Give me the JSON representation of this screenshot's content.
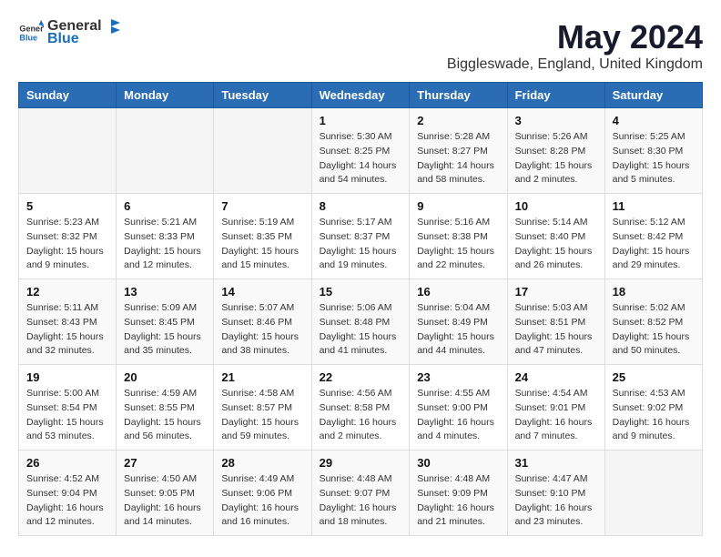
{
  "header": {
    "logo_general": "General",
    "logo_blue": "Blue",
    "title": "May 2024",
    "subtitle": "Biggleswade, England, United Kingdom"
  },
  "calendar": {
    "columns": [
      "Sunday",
      "Monday",
      "Tuesday",
      "Wednesday",
      "Thursday",
      "Friday",
      "Saturday"
    ],
    "rows": [
      [
        {
          "day": "",
          "sunrise": "",
          "sunset": "",
          "daylight": ""
        },
        {
          "day": "",
          "sunrise": "",
          "sunset": "",
          "daylight": ""
        },
        {
          "day": "",
          "sunrise": "",
          "sunset": "",
          "daylight": ""
        },
        {
          "day": "1",
          "sunrise": "Sunrise: 5:30 AM",
          "sunset": "Sunset: 8:25 PM",
          "daylight": "Daylight: 14 hours and 54 minutes."
        },
        {
          "day": "2",
          "sunrise": "Sunrise: 5:28 AM",
          "sunset": "Sunset: 8:27 PM",
          "daylight": "Daylight: 14 hours and 58 minutes."
        },
        {
          "day": "3",
          "sunrise": "Sunrise: 5:26 AM",
          "sunset": "Sunset: 8:28 PM",
          "daylight": "Daylight: 15 hours and 2 minutes."
        },
        {
          "day": "4",
          "sunrise": "Sunrise: 5:25 AM",
          "sunset": "Sunset: 8:30 PM",
          "daylight": "Daylight: 15 hours and 5 minutes."
        }
      ],
      [
        {
          "day": "5",
          "sunrise": "Sunrise: 5:23 AM",
          "sunset": "Sunset: 8:32 PM",
          "daylight": "Daylight: 15 hours and 9 minutes."
        },
        {
          "day": "6",
          "sunrise": "Sunrise: 5:21 AM",
          "sunset": "Sunset: 8:33 PM",
          "daylight": "Daylight: 15 hours and 12 minutes."
        },
        {
          "day": "7",
          "sunrise": "Sunrise: 5:19 AM",
          "sunset": "Sunset: 8:35 PM",
          "daylight": "Daylight: 15 hours and 15 minutes."
        },
        {
          "day": "8",
          "sunrise": "Sunrise: 5:17 AM",
          "sunset": "Sunset: 8:37 PM",
          "daylight": "Daylight: 15 hours and 19 minutes."
        },
        {
          "day": "9",
          "sunrise": "Sunrise: 5:16 AM",
          "sunset": "Sunset: 8:38 PM",
          "daylight": "Daylight: 15 hours and 22 minutes."
        },
        {
          "day": "10",
          "sunrise": "Sunrise: 5:14 AM",
          "sunset": "Sunset: 8:40 PM",
          "daylight": "Daylight: 15 hours and 26 minutes."
        },
        {
          "day": "11",
          "sunrise": "Sunrise: 5:12 AM",
          "sunset": "Sunset: 8:42 PM",
          "daylight": "Daylight: 15 hours and 29 minutes."
        }
      ],
      [
        {
          "day": "12",
          "sunrise": "Sunrise: 5:11 AM",
          "sunset": "Sunset: 8:43 PM",
          "daylight": "Daylight: 15 hours and 32 minutes."
        },
        {
          "day": "13",
          "sunrise": "Sunrise: 5:09 AM",
          "sunset": "Sunset: 8:45 PM",
          "daylight": "Daylight: 15 hours and 35 minutes."
        },
        {
          "day": "14",
          "sunrise": "Sunrise: 5:07 AM",
          "sunset": "Sunset: 8:46 PM",
          "daylight": "Daylight: 15 hours and 38 minutes."
        },
        {
          "day": "15",
          "sunrise": "Sunrise: 5:06 AM",
          "sunset": "Sunset: 8:48 PM",
          "daylight": "Daylight: 15 hours and 41 minutes."
        },
        {
          "day": "16",
          "sunrise": "Sunrise: 5:04 AM",
          "sunset": "Sunset: 8:49 PM",
          "daylight": "Daylight: 15 hours and 44 minutes."
        },
        {
          "day": "17",
          "sunrise": "Sunrise: 5:03 AM",
          "sunset": "Sunset: 8:51 PM",
          "daylight": "Daylight: 15 hours and 47 minutes."
        },
        {
          "day": "18",
          "sunrise": "Sunrise: 5:02 AM",
          "sunset": "Sunset: 8:52 PM",
          "daylight": "Daylight: 15 hours and 50 minutes."
        }
      ],
      [
        {
          "day": "19",
          "sunrise": "Sunrise: 5:00 AM",
          "sunset": "Sunset: 8:54 PM",
          "daylight": "Daylight: 15 hours and 53 minutes."
        },
        {
          "day": "20",
          "sunrise": "Sunrise: 4:59 AM",
          "sunset": "Sunset: 8:55 PM",
          "daylight": "Daylight: 15 hours and 56 minutes."
        },
        {
          "day": "21",
          "sunrise": "Sunrise: 4:58 AM",
          "sunset": "Sunset: 8:57 PM",
          "daylight": "Daylight: 15 hours and 59 minutes."
        },
        {
          "day": "22",
          "sunrise": "Sunrise: 4:56 AM",
          "sunset": "Sunset: 8:58 PM",
          "daylight": "Daylight: 16 hours and 2 minutes."
        },
        {
          "day": "23",
          "sunrise": "Sunrise: 4:55 AM",
          "sunset": "Sunset: 9:00 PM",
          "daylight": "Daylight: 16 hours and 4 minutes."
        },
        {
          "day": "24",
          "sunrise": "Sunrise: 4:54 AM",
          "sunset": "Sunset: 9:01 PM",
          "daylight": "Daylight: 16 hours and 7 minutes."
        },
        {
          "day": "25",
          "sunrise": "Sunrise: 4:53 AM",
          "sunset": "Sunset: 9:02 PM",
          "daylight": "Daylight: 16 hours and 9 minutes."
        }
      ],
      [
        {
          "day": "26",
          "sunrise": "Sunrise: 4:52 AM",
          "sunset": "Sunset: 9:04 PM",
          "daylight": "Daylight: 16 hours and 12 minutes."
        },
        {
          "day": "27",
          "sunrise": "Sunrise: 4:50 AM",
          "sunset": "Sunset: 9:05 PM",
          "daylight": "Daylight: 16 hours and 14 minutes."
        },
        {
          "day": "28",
          "sunrise": "Sunrise: 4:49 AM",
          "sunset": "Sunset: 9:06 PM",
          "daylight": "Daylight: 16 hours and 16 minutes."
        },
        {
          "day": "29",
          "sunrise": "Sunrise: 4:48 AM",
          "sunset": "Sunset: 9:07 PM",
          "daylight": "Daylight: 16 hours and 18 minutes."
        },
        {
          "day": "30",
          "sunrise": "Sunrise: 4:48 AM",
          "sunset": "Sunset: 9:09 PM",
          "daylight": "Daylight: 16 hours and 21 minutes."
        },
        {
          "day": "31",
          "sunrise": "Sunrise: 4:47 AM",
          "sunset": "Sunset: 9:10 PM",
          "daylight": "Daylight: 16 hours and 23 minutes."
        },
        {
          "day": "",
          "sunrise": "",
          "sunset": "",
          "daylight": ""
        }
      ]
    ]
  }
}
